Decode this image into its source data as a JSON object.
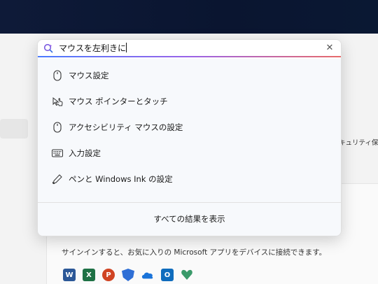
{
  "search": {
    "query": "マウスを左利きに",
    "clear_label": "✕"
  },
  "results": [
    {
      "label": "マウス設定",
      "icon": "mouse-icon"
    },
    {
      "label": "マウス ポインターとタッチ",
      "icon": "pointer-touch-icon"
    },
    {
      "label": "アクセシビリティ マウスの設定",
      "icon": "mouse-icon"
    },
    {
      "label": "入力設定",
      "icon": "keyboard-icon"
    },
    {
      "label": "ペンと Windows Ink の設定",
      "icon": "pen-icon"
    }
  ],
  "show_all_label": "すべての結果を表示",
  "background": {
    "right_text": "キュリティ保護し",
    "signin_text": "サインインすると、お気に入りの Microsoft アプリをデバイスに接続できます。",
    "apps": [
      {
        "name": "word-icon",
        "letter": "W",
        "color": "#2b5797"
      },
      {
        "name": "excel-icon",
        "letter": "X",
        "color": "#1e7145"
      },
      {
        "name": "powerpoint-icon",
        "letter": "P",
        "color": "#d04423"
      },
      {
        "name": "defender-icon",
        "letter": "",
        "color": "#2f6fd6"
      },
      {
        "name": "onedrive-icon",
        "letter": "",
        "color": "#1a73d9"
      },
      {
        "name": "outlook-icon",
        "letter": "O",
        "color": "#0f6cbd"
      },
      {
        "name": "family-icon",
        "letter": "",
        "color": "#3a9a6a"
      }
    ]
  }
}
